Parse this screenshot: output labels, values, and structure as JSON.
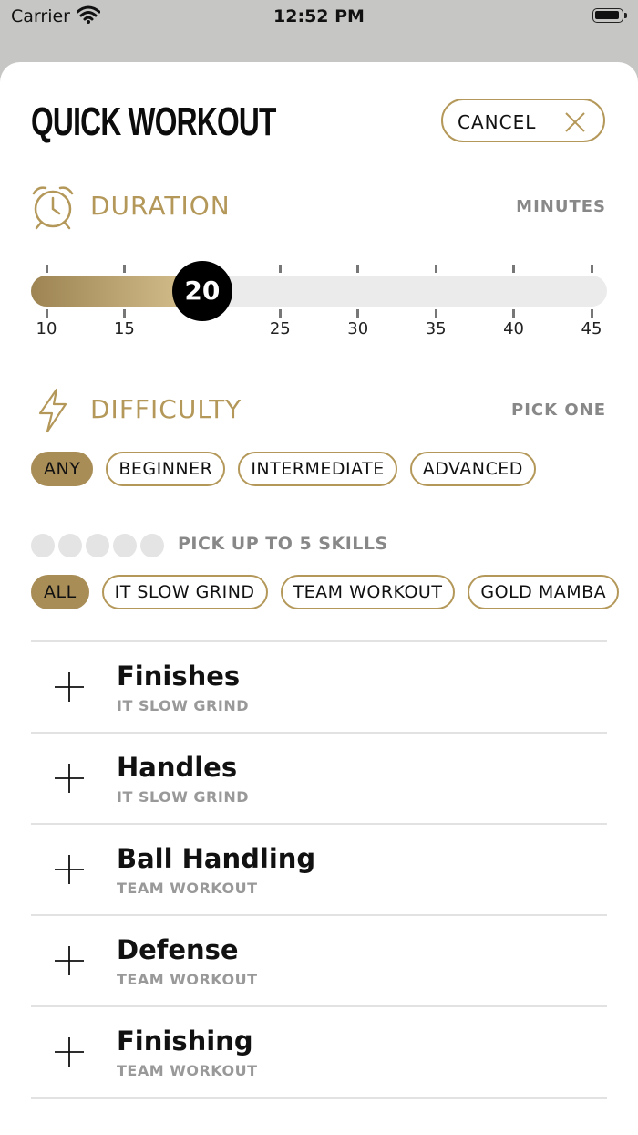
{
  "status_bar": {
    "carrier": "Carrier",
    "time": "12:52 PM"
  },
  "header": {
    "title": "QUICK WORKOUT",
    "cancel_label": "CANCEL"
  },
  "duration": {
    "title": "DURATION",
    "hint": "MINUTES",
    "min": 10,
    "max": 45,
    "value": 20,
    "value_label": "20",
    "ticks": [
      "10",
      "15",
      "20",
      "25",
      "30",
      "35",
      "40",
      "45"
    ]
  },
  "difficulty": {
    "title": "DIFFICULTY",
    "hint": "PICK ONE",
    "options": [
      {
        "label": "ANY",
        "selected": true
      },
      {
        "label": "BEGINNER",
        "selected": false
      },
      {
        "label": "INTERMEDIATE",
        "selected": false
      },
      {
        "label": "ADVANCED",
        "selected": false
      }
    ]
  },
  "skills": {
    "hint": "PICK UP TO 5 SKILLS",
    "selected_count": 0,
    "max": 5,
    "filters": [
      {
        "label": "ALL",
        "selected": true
      },
      {
        "label": "IT SLOW GRIND",
        "selected": false
      },
      {
        "label": "TEAM WORKOUT",
        "selected": false
      },
      {
        "label": "GOLD MAMBA",
        "selected": false
      }
    ]
  },
  "workouts": [
    {
      "title": "Finishes",
      "category": "IT SLOW GRIND"
    },
    {
      "title": "Handles",
      "category": "IT SLOW GRIND"
    },
    {
      "title": "Ball Handling",
      "category": "TEAM WORKOUT"
    },
    {
      "title": "Defense",
      "category": "TEAM WORKOUT"
    },
    {
      "title": "Finishing",
      "category": "TEAM WORKOUT"
    }
  ],
  "colors": {
    "accent": "#b4985a",
    "accent_fill": "#a98d57",
    "thumb": "#000000"
  }
}
